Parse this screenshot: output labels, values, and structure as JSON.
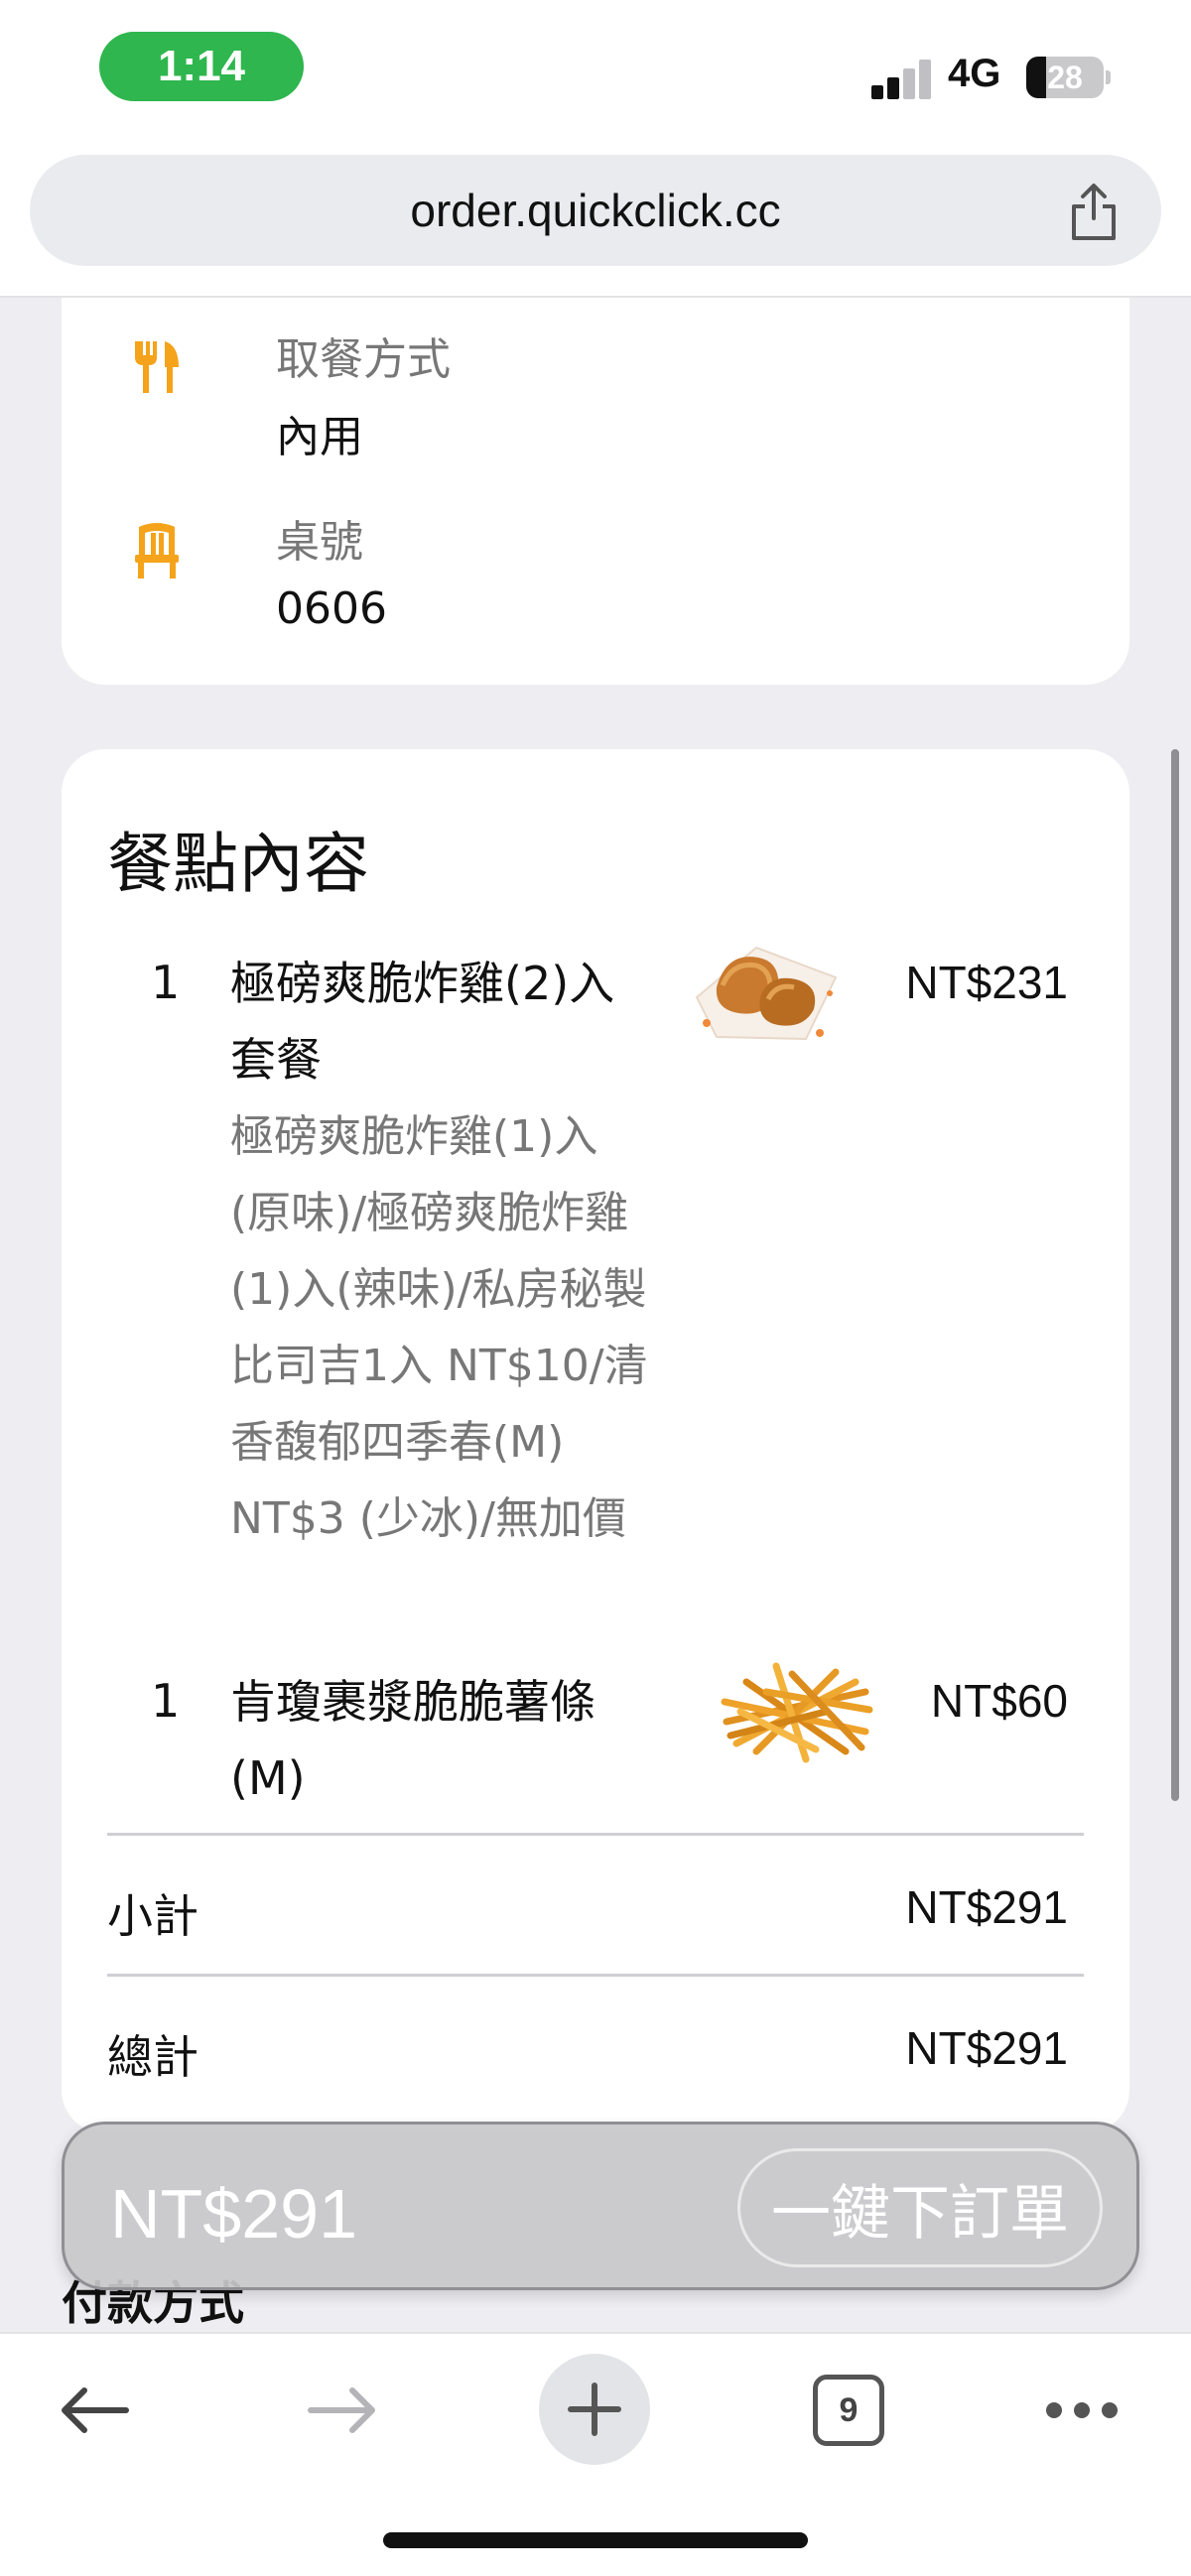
{
  "status_bar": {
    "time": "1:14",
    "network": "4G",
    "battery": "28"
  },
  "browser": {
    "url": "order.quickclick.cc"
  },
  "pickup": {
    "method_label": "取餐方式",
    "method_value": "內用",
    "table_label": "桌號",
    "table_value": "0606"
  },
  "order": {
    "section_title": "餐點內容",
    "items": [
      {
        "qty": "1",
        "name": "極磅爽脆炸雞(2)入套餐",
        "description": "極磅爽脆炸雞(1)入(原味)/極磅爽脆炸雞(1)入(辣味)/私房秘製比司吉1入 NT$10/清香馥郁四季春(M) NT$3 (少冰)/無加價",
        "price": "NT$231",
        "image": "fried-chicken"
      },
      {
        "qty": "1",
        "name": "肯瓊裹漿脆脆薯條(M)",
        "description": "",
        "price": "NT$60",
        "image": "french-fries"
      }
    ],
    "subtotal_label": "小計",
    "subtotal_value": "NT$291",
    "total_label": "總計",
    "total_value": "NT$291"
  },
  "order_bar": {
    "total": "NT$291",
    "button_label": "一鍵下訂單"
  },
  "payment": {
    "label": "付款方式"
  },
  "toolbar": {
    "tab_count": "9"
  },
  "colors": {
    "accent_orange": "#f5a31a",
    "status_green": "#2fb64e"
  }
}
